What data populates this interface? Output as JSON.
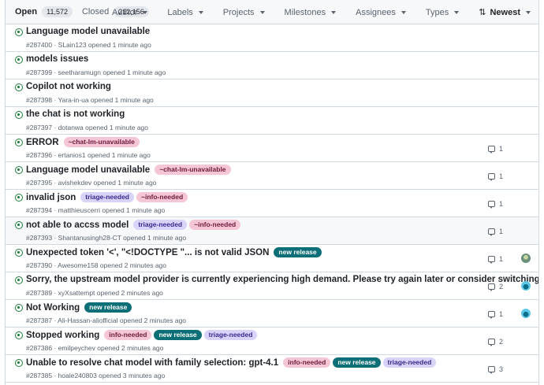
{
  "header": {
    "open_label": "Open",
    "open_count": "11,572",
    "closed_label": "Closed",
    "closed_count": "212,156",
    "filters": [
      "Author",
      "Labels",
      "Projects",
      "Milestones",
      "Assignees",
      "Types"
    ],
    "sort_label": "Newest"
  },
  "issues": [
    {
      "title": "Language model unavailable",
      "labels": [],
      "meta": "#287400 · SLain123 opened 1 minute ago",
      "comments": "",
      "avatar": ""
    },
    {
      "title": "models issues",
      "labels": [],
      "meta": "#287399 · seetharamugn opened 1 minute ago",
      "comments": "",
      "avatar": ""
    },
    {
      "title": "Copilot not working",
      "labels": [],
      "meta": "#287398 · Yara-in-ua opened 1 minute ago",
      "comments": "",
      "avatar": ""
    },
    {
      "title": "the chat is not working",
      "labels": [],
      "meta": "#287397 · dotanwa opened 1 minute ago",
      "comments": "",
      "avatar": ""
    },
    {
      "title": "ERROR",
      "labels": [
        {
          "text": "~chat-lm-unavailable",
          "kind": "lm"
        }
      ],
      "meta": "#287396 · ertanios1 opened 1 minute ago",
      "comments": "1",
      "avatar": ""
    },
    {
      "title": "Language model unavailable",
      "labels": [
        {
          "text": "~chat-lm-unavailable",
          "kind": "lm"
        }
      ],
      "meta": "#287395 · avishekdev opened 1 minute ago",
      "comments": "1",
      "avatar": ""
    },
    {
      "title": "invalid json",
      "labels": [
        {
          "text": "triage-needed",
          "kind": "triage"
        },
        {
          "text": "~info-needed",
          "kind": "info"
        }
      ],
      "meta": "#287394 · matthieuscerri opened 1 minute ago",
      "comments": "1",
      "avatar": ""
    },
    {
      "title": "not able to accss model",
      "labels": [
        {
          "text": "triage-needed",
          "kind": "triage"
        },
        {
          "text": "~info-needed",
          "kind": "info"
        }
      ],
      "meta": "#287393 · Shantanusingh28-CT opened 1 minute ago",
      "comments": "1",
      "avatar": "",
      "highlight": true
    },
    {
      "title": "Unexpected token '<', \"<!DOCTYPE \"... is not valid JSON",
      "labels": [
        {
          "text": "new release",
          "kind": "newrel"
        }
      ],
      "meta": "#287390 · Awesome158 opened 2 minutes ago",
      "comments": "1",
      "avatar": "a1"
    },
    {
      "title": "Sorry, the upstream model provider is currently experiencing high demand. Please try again later or consider switching models.",
      "labels": [],
      "meta": "#287389 · xyXsattempt opened 2 minutes ago",
      "comments": "2",
      "avatar": "a2"
    },
    {
      "title": "Not Working",
      "labels": [
        {
          "text": "new release",
          "kind": "newrel"
        }
      ],
      "meta": "#287387 · Ali-Hassan-aliofficial opened 2 minutes ago",
      "comments": "1",
      "avatar": "a3"
    },
    {
      "title": "Stopped working",
      "labels": [
        {
          "text": "info-needed",
          "kind": "info"
        },
        {
          "text": "new release",
          "kind": "newrel"
        },
        {
          "text": "triage-needed",
          "kind": "triage"
        }
      ],
      "meta": "#287386 · emilpeychev opened 2 minutes ago",
      "comments": "2",
      "avatar": ""
    },
    {
      "title": "Unable to resolve chat model with family selection: gpt-4.1",
      "labels": [
        {
          "text": "info-needed",
          "kind": "info"
        },
        {
          "text": "new release",
          "kind": "newrel"
        },
        {
          "text": "triage-needed",
          "kind": "triage"
        }
      ],
      "meta": "#287385 · hoale240803 opened 3 minutes ago",
      "comments": "3",
      "avatar": ""
    }
  ]
}
